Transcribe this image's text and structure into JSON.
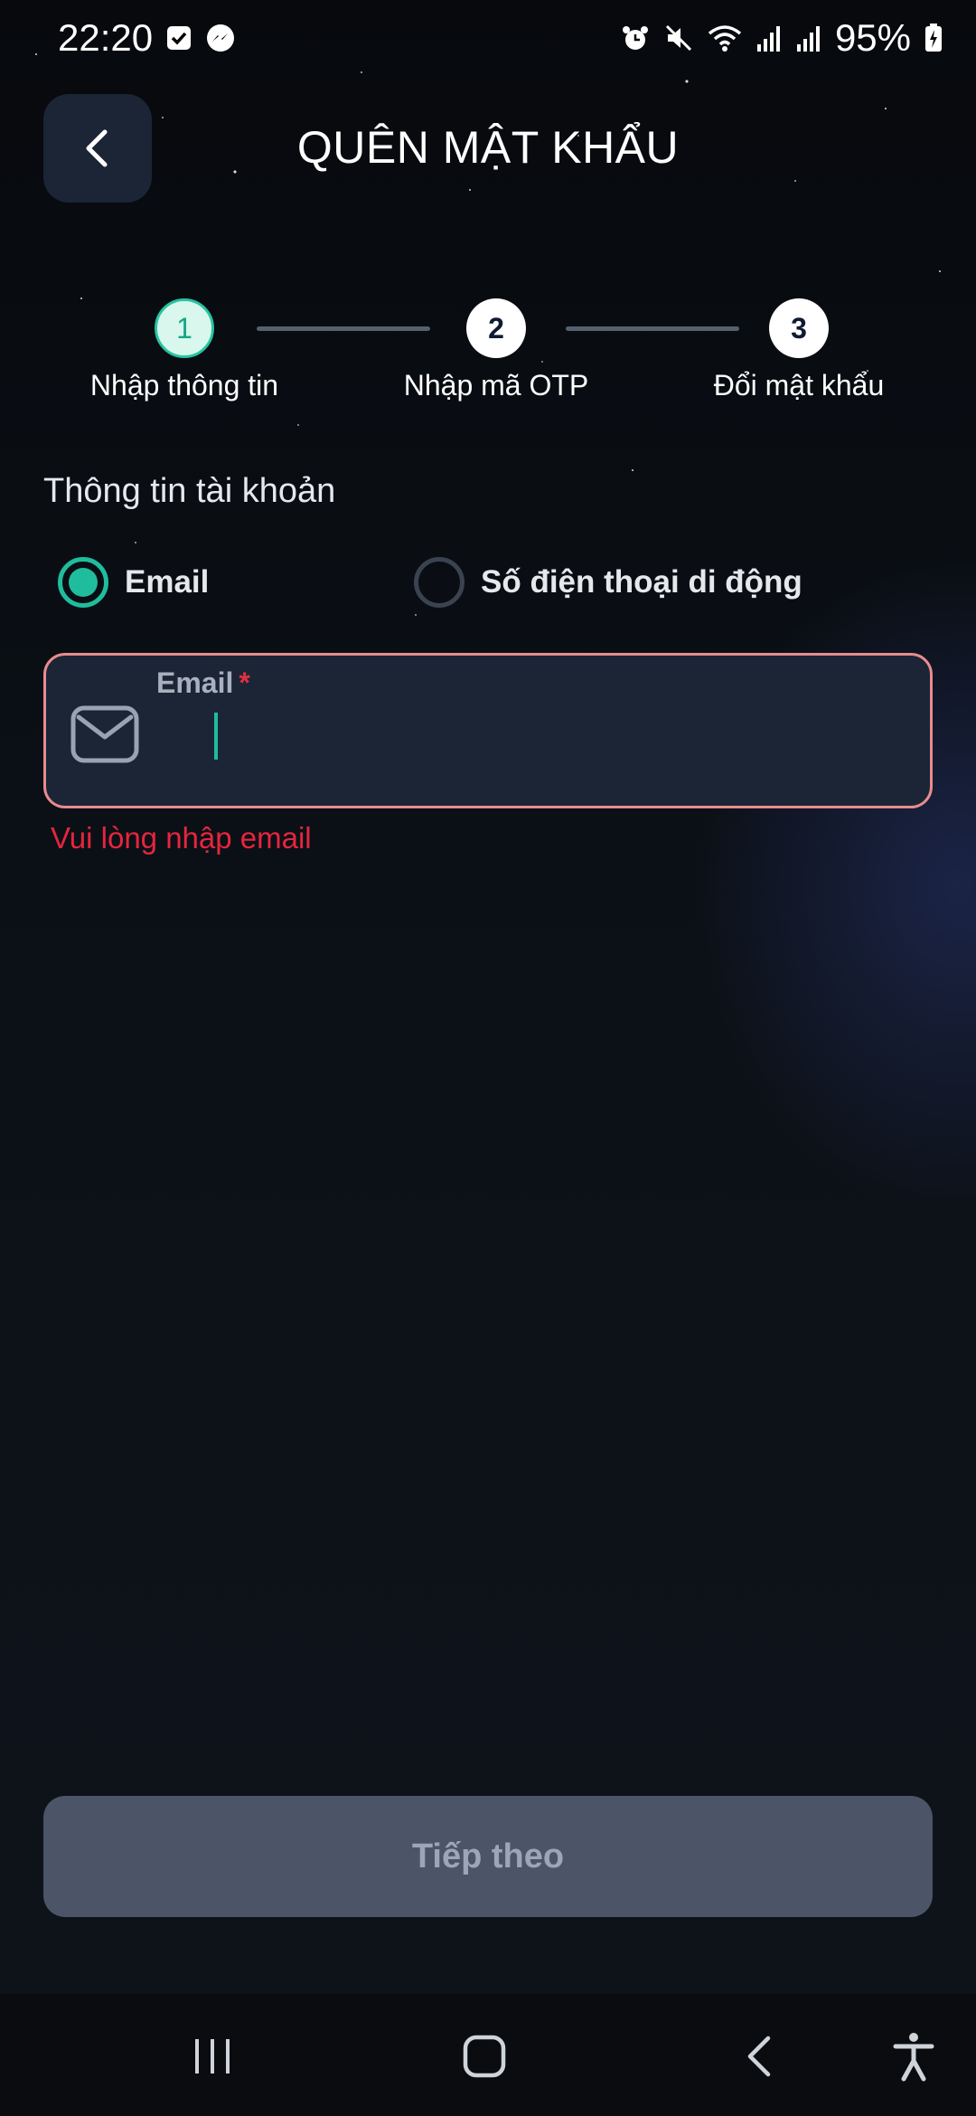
{
  "status_bar": {
    "time": "22:20",
    "battery": "95%"
  },
  "header": {
    "title": "QUÊN MẬT KHẨU"
  },
  "stepper": {
    "steps": [
      {
        "number": "1",
        "label": "Nhập thông tin",
        "state": "active"
      },
      {
        "number": "2",
        "label": "Nhập mã OTP",
        "state": "pending"
      },
      {
        "number": "3",
        "label": "Đổi mật khẩu",
        "state": "pending"
      }
    ]
  },
  "form": {
    "section_label": "Thông tin tài khoản",
    "radio_options": [
      {
        "label": "Email",
        "selected": true
      },
      {
        "label": "Số điện thoại di động",
        "selected": false
      }
    ],
    "email_field": {
      "label": "Email",
      "required_mark": "*",
      "value": ""
    },
    "error_message": "Vui lòng nhập email"
  },
  "actions": {
    "next_label": "Tiếp theo"
  },
  "colors": {
    "accent": "#1fbd9e",
    "error": "#e6253e",
    "field_bg": "#1b2535",
    "button_disabled": "#4b5567"
  }
}
